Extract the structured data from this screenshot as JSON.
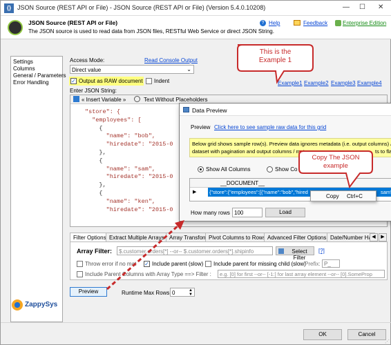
{
  "window": {
    "title": "JSON Source (REST API or File) - JSON Source (REST API or File) (Version 5.4.0.10208)",
    "minimize": "—",
    "maximize": "☐",
    "close": "✕"
  },
  "header": {
    "heading": "JSON Source (REST API or File)",
    "description": "The JSON source is used to read data from JSON files, RESTful Web Service or direct JSON String.",
    "help": "Help",
    "feedback": "Feedback",
    "enterprise": "Enterprise Edition"
  },
  "nav": {
    "items": [
      "Settings",
      "Columns",
      "General / Parameters",
      "Error Handling"
    ]
  },
  "access": {
    "label": "Access Mode:",
    "read_console": "Read Console Output",
    "mode_value": "Direct value",
    "raw_label": "Output as RAW document",
    "indent_label": "Indent"
  },
  "examples": [
    "Example1",
    "Example2",
    "Example3",
    "Example4"
  ],
  "json_editor": {
    "label": "Enter JSON String:",
    "insert_variable": "« Insert Variable »",
    "text_without_placeholders": "Text Without Placeholders",
    "lines": [
      "\"store\": {",
      "  \"employees\": [",
      "    {",
      "      \"name\": \"bob\",",
      "      \"hiredate\": \"2015-0",
      "    },",
      "    {",
      "      \"name\": \"sam\",",
      "      \"hiredate\": \"2015-0",
      "    },",
      "    {",
      "      \"name\": \"ken\",",
      "      \"hiredate\": \"2015-0"
    ]
  },
  "tabs": [
    "Filter Options",
    "Extract Multiple Arrays",
    "Array Transform",
    "Pivot Columns to Rows",
    "Advanced Filter Options",
    "Date/Number Ha"
  ],
  "filter": {
    "label": "Array Filter:",
    "value": "$.customer.orders[*] --or-- $.customer.orders[*].shipinfo",
    "select_button": "Select Filter",
    "help": "[?]",
    "throw_error": "Throw error if no mat",
    "include_parent": "Include parent (slow)",
    "include_parent_missing": "Include parent for missing child (slow)",
    "prefix_label": "Prefix:",
    "prefix_value": "P_",
    "include_parent_columns": "Include Parent Columns with Array Type ==> Filter :",
    "filter_placeholder": "e.g. [0] for first --or-- [-1:] for last array element --or-- [0].SomeProp"
  },
  "footer": {
    "preview": "Preview",
    "runtime_label": "Runtime Max Rows:",
    "runtime_value": "0",
    "ok": "OK",
    "cancel": "Cancel",
    "brand": "ZappySys"
  },
  "preview_dialog": {
    "title": "Data Preview",
    "preview_label": "Preview",
    "sample_link": "Click here to see sample raw data for this grid",
    "info_line1": "Below grid shows sample row(s). Preview data ignores metadata (i.e. output columns) / pa",
    "info_line2": "dataset with pagination and output columns / meta",
    "info_line2_end": "ts to flat.",
    "show_all": "Show All Columns",
    "show_co": "Show Co",
    "column_header": "__DOCUMENT__",
    "row_value": "{\"store\":{\"employees\":[{\"name\":\"bob\",\"hired",
    "row_value_tail": "sam\",\"h",
    "how_many_label": "How many rows",
    "how_many_value": "100",
    "load": "Load"
  },
  "context_menu": {
    "item": "Copy",
    "shortcut": "Ctrl+C"
  },
  "annotations": {
    "example_callout": "This is the\nExample 1",
    "copy_callout": "Copy The JSON\nexample"
  },
  "colors": {
    "accent_red": "#c72a2a",
    "link_blue": "#0645d4",
    "highlight_yellow": "#ffff7f",
    "selection_blue": "#0078d7"
  }
}
